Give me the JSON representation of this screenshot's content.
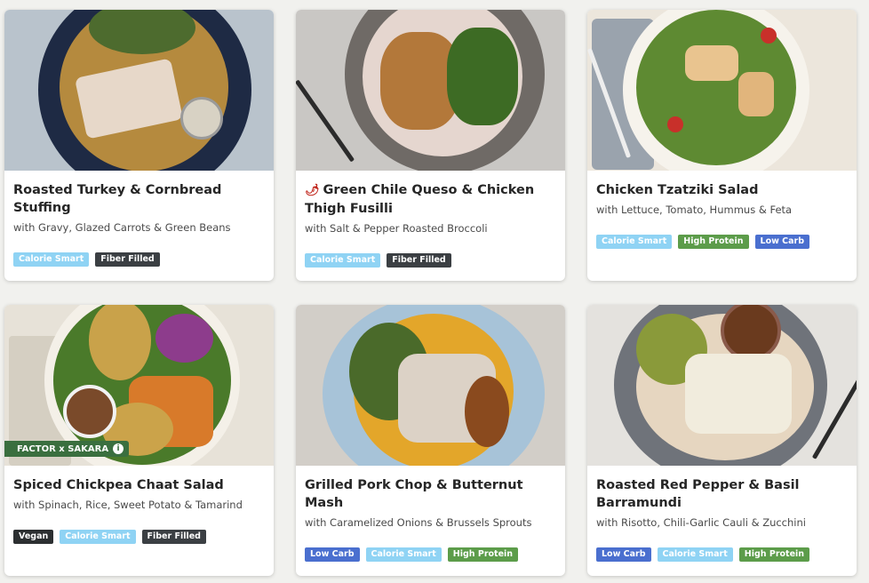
{
  "cards": [
    {
      "title": "Roasted Turkey & Cornbread Stuffing",
      "subtitle": "with Gravy, Glazed Carrots & Green Beans",
      "tags": [
        "Calorie Smart",
        "Fiber Filled"
      ]
    },
    {
      "title": "Green Chile Queso & Chicken Thigh Fusilli",
      "spicy_icon": "chili-pepper-icon",
      "subtitle": "with Salt & Pepper Roasted Broccoli",
      "tags": [
        "Calorie Smart",
        "Fiber Filled"
      ]
    },
    {
      "title": "Chicken Tzatziki Salad",
      "subtitle": "with Lettuce, Tomato, Hummus & Feta",
      "tags": [
        "Calorie Smart",
        "High Protein",
        "Low Carb"
      ]
    },
    {
      "title": "Spiced Chickpea Chaat Salad",
      "subtitle": "with Spinach, Rice, Sweet Potato & Tamarind",
      "badge": "FACTOR x SAKARA",
      "badge_icon": "info-icon",
      "tags": [
        "Vegan",
        "Calorie Smart",
        "Fiber Filled"
      ]
    },
    {
      "title": "Grilled Pork Chop & Butternut Mash",
      "subtitle": "with Caramelized Onions & Brussels Sprouts",
      "tags": [
        "Low Carb",
        "Calorie Smart",
        "High Protein"
      ]
    },
    {
      "title": "Roasted Red Pepper & Basil Barramundi",
      "subtitle": "with Risotto, Chili-Garlic Cauli & Zucchini",
      "tags": [
        "Low Carb",
        "Calorie Smart",
        "High Protein"
      ]
    }
  ],
  "tag_colors": {
    "Calorie Smart": "#8fd3f4",
    "Fiber Filled": "#3b3f43",
    "High Protein": "#5c9c4a",
    "Low Carb": "#4a6fcf",
    "Vegan": "#2c2f31"
  }
}
